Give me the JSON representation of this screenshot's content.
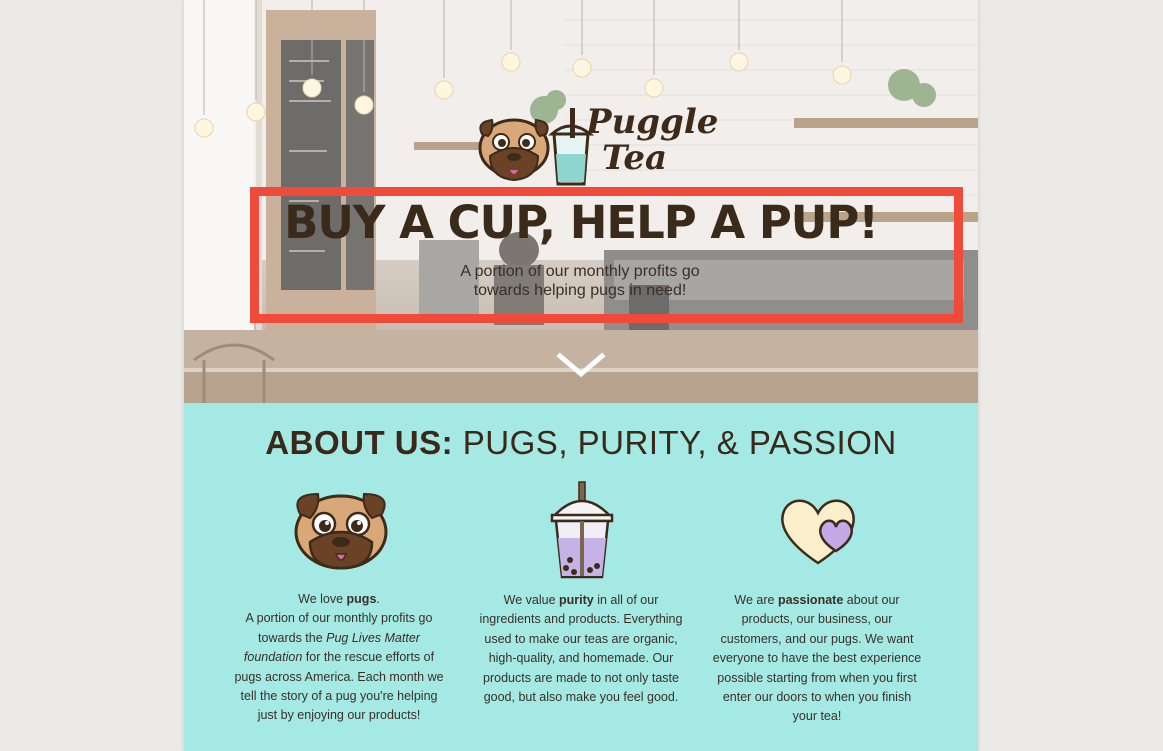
{
  "logo": {
    "line1": "Puggle",
    "line2": "Tea"
  },
  "hero": {
    "headline": "BUY A CUP, HELP A PUP!",
    "subline": "A portion of our monthly profits go towards helping pugs in need!",
    "scroll_icon": "chevron-down-icon"
  },
  "about": {
    "title_bold": "ABOUT US:",
    "title_rest": "PUGS, PURITY, & PASSION",
    "columns": [
      {
        "icon": "pug-face-icon",
        "intro_pre": "We love ",
        "intro_bold": "pugs",
        "intro_post": ".",
        "text_pre": "A portion of our monthly profits go towards the ",
        "text_italic": "Pug Lives Matter foundation",
        "text_post": " for the rescue efforts of pugs across America. Each month we tell the story of a pug you're helping just by enjoying our products!"
      },
      {
        "icon": "bubble-tea-icon",
        "text_pre": "We  value ",
        "text_bold": "purity",
        "text_post": " in all of our ingredients and products. Everything used to make our teas are organic, high-quality, and homemade.  Our products are made to not only taste good, but also make you feel good."
      },
      {
        "icon": "two-hearts-icon",
        "text_pre": "We are ",
        "text_bold": "passionate",
        "text_post": " about our products, our business, our customers, and our pugs.  We want everyone to have the best experience possible starting from when you first enter our doors to when you finish your tea!"
      }
    ]
  },
  "colors": {
    "accent_highlight": "#f04a3b",
    "about_background": "#a5e9e5",
    "text_dark": "#3a2818"
  }
}
